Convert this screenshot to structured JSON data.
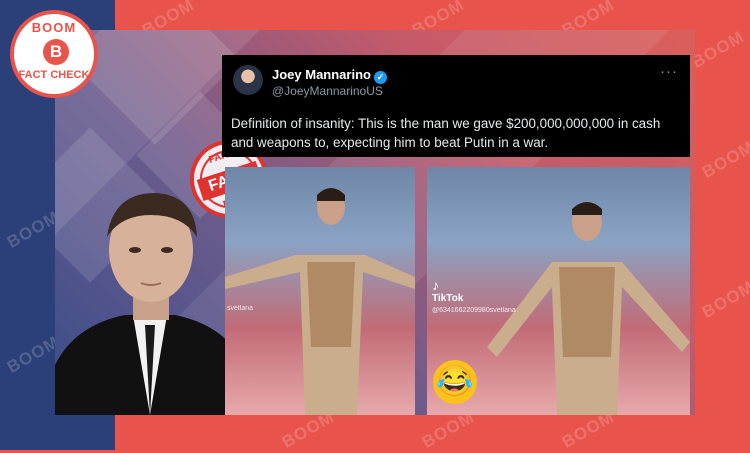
{
  "brand": {
    "logo_top": "BOOM",
    "logo_letter": "B",
    "logo_bottom": "FACT CHECK",
    "watermark": "BOOM"
  },
  "stamp": {
    "top": "FAKE",
    "main": "FAKE",
    "bottom": "FAKE",
    "color": "#e0322f"
  },
  "tweet": {
    "name": "Joey Mannarino",
    "handle": "@JoeyMannarinoUS",
    "verified_icon": "verified-badge-icon",
    "more_icon": "more-options-icon",
    "more_glyph": "···",
    "text": "Definition of insanity: This is the man we gave $200,000,000,000 in cash and weapons to, expecting him to beat Putin in a war."
  },
  "video": {
    "tiktok_label": "TikTok",
    "tiktok_handle": "@6341662209980svetlana",
    "left_handle": "svetlana",
    "emoji_icon": "laughing-face-icon"
  },
  "colors": {
    "brand_red": "#e8534b",
    "navy": "#2b3f78",
    "twitter_blue": "#1d9bf0"
  }
}
